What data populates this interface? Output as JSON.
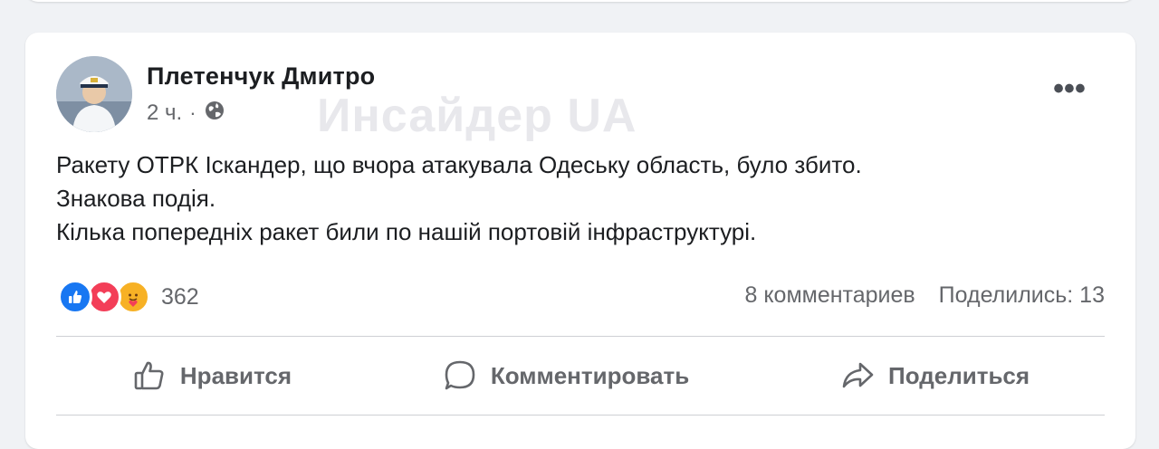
{
  "post": {
    "author": "Плетенчук Дмитро",
    "time": "2 ч.",
    "privacy_icon": "globe-icon",
    "watermark": "Инсайдер UA",
    "text_lines": [
      "Ракету ОТРК Іскандер, що вчора атакувала Одеську область, було збито.",
      "Знакова подія.",
      "Кілька попередніх ракет били по нашій портовій інфраструктурі."
    ]
  },
  "reactions": {
    "icons": [
      "like-icon",
      "love-icon",
      "care-icon"
    ],
    "count": "362",
    "comments": "8 комментариев",
    "shares": "Поделились: 13"
  },
  "actions": {
    "like": "Нравится",
    "comment": "Комментировать",
    "share": "Поделиться"
  },
  "colors": {
    "like": "#1877f2",
    "love": "#f33e58",
    "care": "#f7b125",
    "secondary_text": "#65676b",
    "background": "#f0f2f5"
  }
}
